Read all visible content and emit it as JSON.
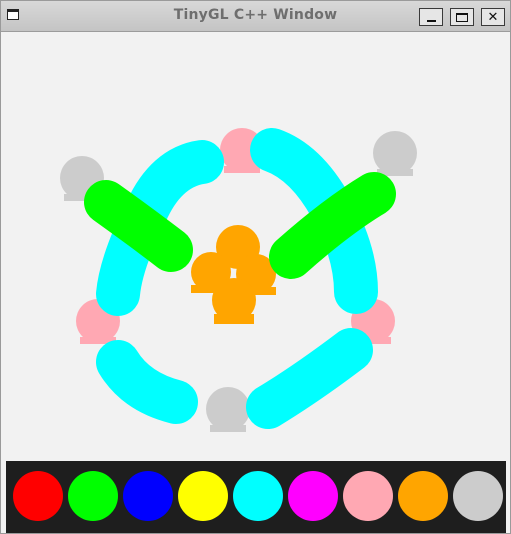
{
  "window": {
    "title": "TinyGL C++ Window",
    "controls": [
      "minimize-icon",
      "maximize-icon",
      "close-icon"
    ]
  },
  "palette": {
    "colors": [
      {
        "name": "red",
        "hex": "#ff0000"
      },
      {
        "name": "green",
        "hex": "#00ff00"
      },
      {
        "name": "blue",
        "hex": "#0000ff"
      },
      {
        "name": "yellow",
        "hex": "#ffff00"
      },
      {
        "name": "cyan",
        "hex": "#00ffff"
      },
      {
        "name": "magenta",
        "hex": "#ff00ff"
      },
      {
        "name": "pink",
        "hex": "#ffa8b3"
      },
      {
        "name": "orange",
        "hex": "#ffa500"
      },
      {
        "name": "light-gray",
        "hex": "#cccccc"
      }
    ]
  },
  "drawing": {
    "stroke_colors": {
      "cyan": "#00ffff",
      "green": "#00ff00",
      "orange": "#ffa500",
      "pink": "#ffa8b3",
      "gray": "#cccccc"
    }
  }
}
